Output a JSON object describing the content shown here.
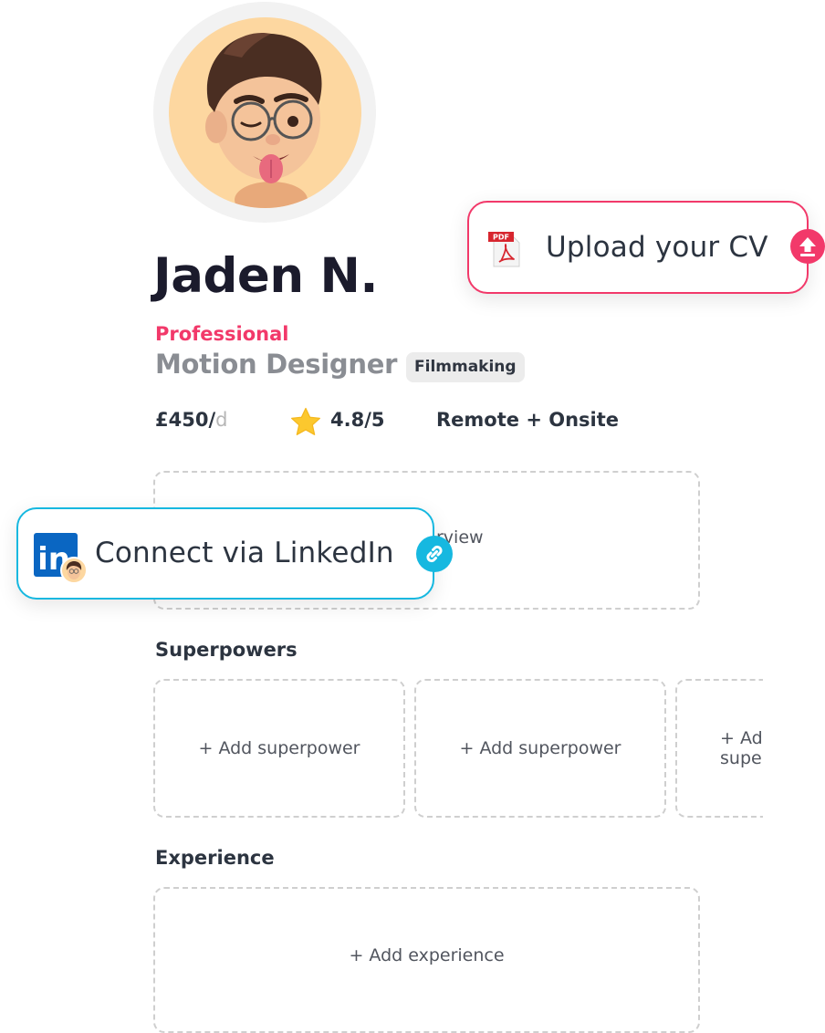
{
  "profile": {
    "name": "Jaden N.",
    "level": "Professional",
    "role": "Motion Designer",
    "tag": "Filmmaking",
    "rate": "£450/",
    "rate_unit": "d",
    "rating": "4.8/5",
    "location": "Remote + Onsite"
  },
  "overview": {
    "label": "Overview",
    "visible_fragment": "rview"
  },
  "superpowers": {
    "title": "Superpowers",
    "slots": [
      "+ Add superpower",
      "+ Add superpower",
      "+ Add superpower"
    ]
  },
  "experience": {
    "title": "Experience",
    "add_label": "+ Add experience"
  },
  "cv_card": {
    "label": "Upload your CV",
    "file_icon": "pdf-icon",
    "file_icon_text": "PDF",
    "action_icon": "upload-icon",
    "accent": "#f2396a"
  },
  "linkedin_card": {
    "label": "Connect via LinkedIn",
    "logo_icon": "linkedin-icon",
    "logo_text": "in",
    "action_icon": "link-icon",
    "accent": "#16b8e0"
  },
  "colors": {
    "accent_pink": "#f2396a",
    "accent_blue": "#16b8e0",
    "linkedin_blue": "#0a66c2",
    "star": "#fcc82e"
  }
}
